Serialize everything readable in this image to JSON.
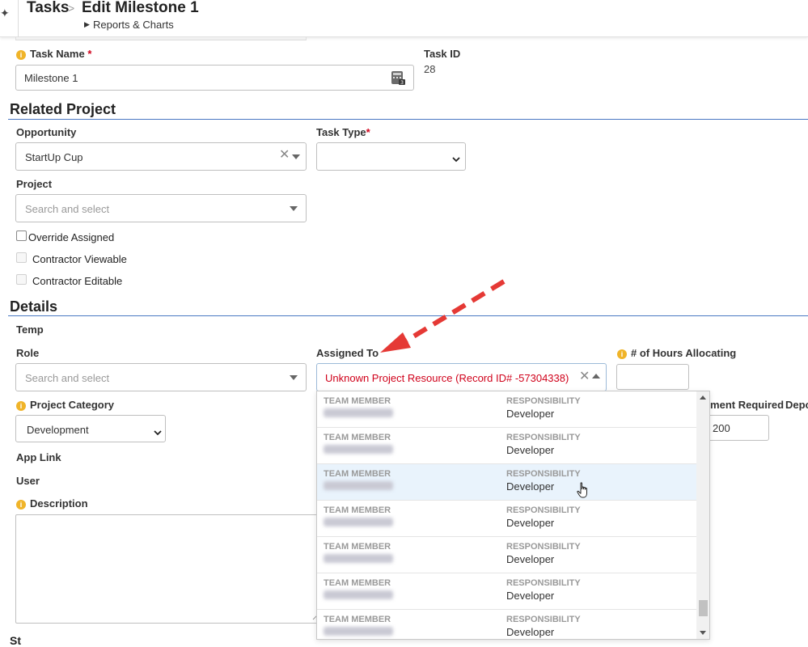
{
  "header": {
    "breadcrumb_root": "Tasks",
    "breadcrumb_separator": ">",
    "page_title": "Edit Milestone 1",
    "sub_link": "Reports & Charts"
  },
  "task": {
    "name_label": "Task Name",
    "required_mark": "*",
    "name_value": "Milestone 1",
    "id_label": "Task ID",
    "id_value": "28"
  },
  "related_project": {
    "title": "Related Project",
    "opportunity_label": "Opportunity",
    "opportunity_value": "StartUp Cup",
    "task_type_label": "Task Type",
    "task_type_value": "",
    "project_label": "Project",
    "project_placeholder": "Search and select",
    "override_assigned_label": "Override Assigned",
    "contractor_viewable_label": "Contractor Viewable",
    "contractor_editable_label": "Contractor Editable"
  },
  "details": {
    "title": "Details",
    "temp_label": "Temp",
    "role_label": "Role",
    "role_placeholder": "Search and select",
    "assigned_to_label": "Assigned To",
    "assigned_to_value": "Unknown Project Resource (Record ID# -57304338)",
    "hours_label": "# of Hours Allocating",
    "hours_value": "",
    "project_category_label": "Project Category",
    "project_category_value": "Development",
    "app_link_label": "App Link",
    "user_label": "User",
    "description_label": "Description",
    "payment_required_fragment": "rment Required",
    "deposit_fragment": "Depo",
    "amount_fragment": "200"
  },
  "assigned_dropdown": {
    "rows": [
      {
        "member_header": "TEAM MEMBER",
        "responsibility_header": "RESPONSIBILITY",
        "responsibility": "Developer"
      },
      {
        "member_header": "TEAM MEMBER",
        "responsibility_header": "RESPONSIBILITY",
        "responsibility": "Developer"
      },
      {
        "member_header": "TEAM MEMBER",
        "responsibility_header": "RESPONSIBILITY",
        "responsibility": "Developer"
      },
      {
        "member_header": "TEAM MEMBER",
        "responsibility_header": "RESPONSIBILITY",
        "responsibility": "Developer"
      },
      {
        "member_header": "TEAM MEMBER",
        "responsibility_header": "RESPONSIBILITY",
        "responsibility": "Developer"
      },
      {
        "member_header": "TEAM MEMBER",
        "responsibility_header": "RESPONSIBILITY",
        "responsibility": "Developer"
      },
      {
        "member_header": "TEAM MEMBER",
        "responsibility_header": "RESPONSIBILITY",
        "responsibility": "Developer"
      }
    ]
  },
  "colors": {
    "section_rule": "#4a78c2",
    "required": "#d0021b",
    "annotation_arrow": "#e53935",
    "hover_row": "#e9f3fc"
  },
  "icons": {
    "info": "info-icon",
    "calculator": "calculator-icon",
    "clear": "clear-icon",
    "caret": "caret-icon",
    "cursor": "hand-cursor-icon",
    "arrow": "annotation-arrow"
  }
}
